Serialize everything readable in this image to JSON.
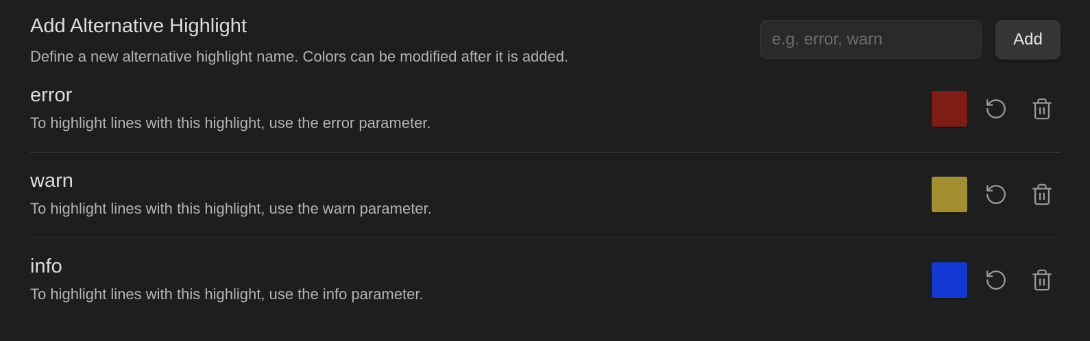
{
  "header": {
    "title": "Add Alternative Highlight",
    "description": "Define a new alternative highlight name. Colors can be modified after it is added.",
    "input_placeholder": "e.g. error, warn",
    "input_value": "",
    "add_label": "Add"
  },
  "highlights": [
    {
      "name": "error",
      "description": "To highlight lines with this highlight, use the error parameter.",
      "color": "#7f1c15"
    },
    {
      "name": "warn",
      "description": "To highlight lines with this highlight, use the warn parameter.",
      "color": "#a38f2f"
    },
    {
      "name": "info",
      "description": "To highlight lines with this highlight, use the info parameter.",
      "color": "#1438d4"
    }
  ],
  "icons": {
    "reset": "reset-icon",
    "delete": "trash-icon"
  }
}
